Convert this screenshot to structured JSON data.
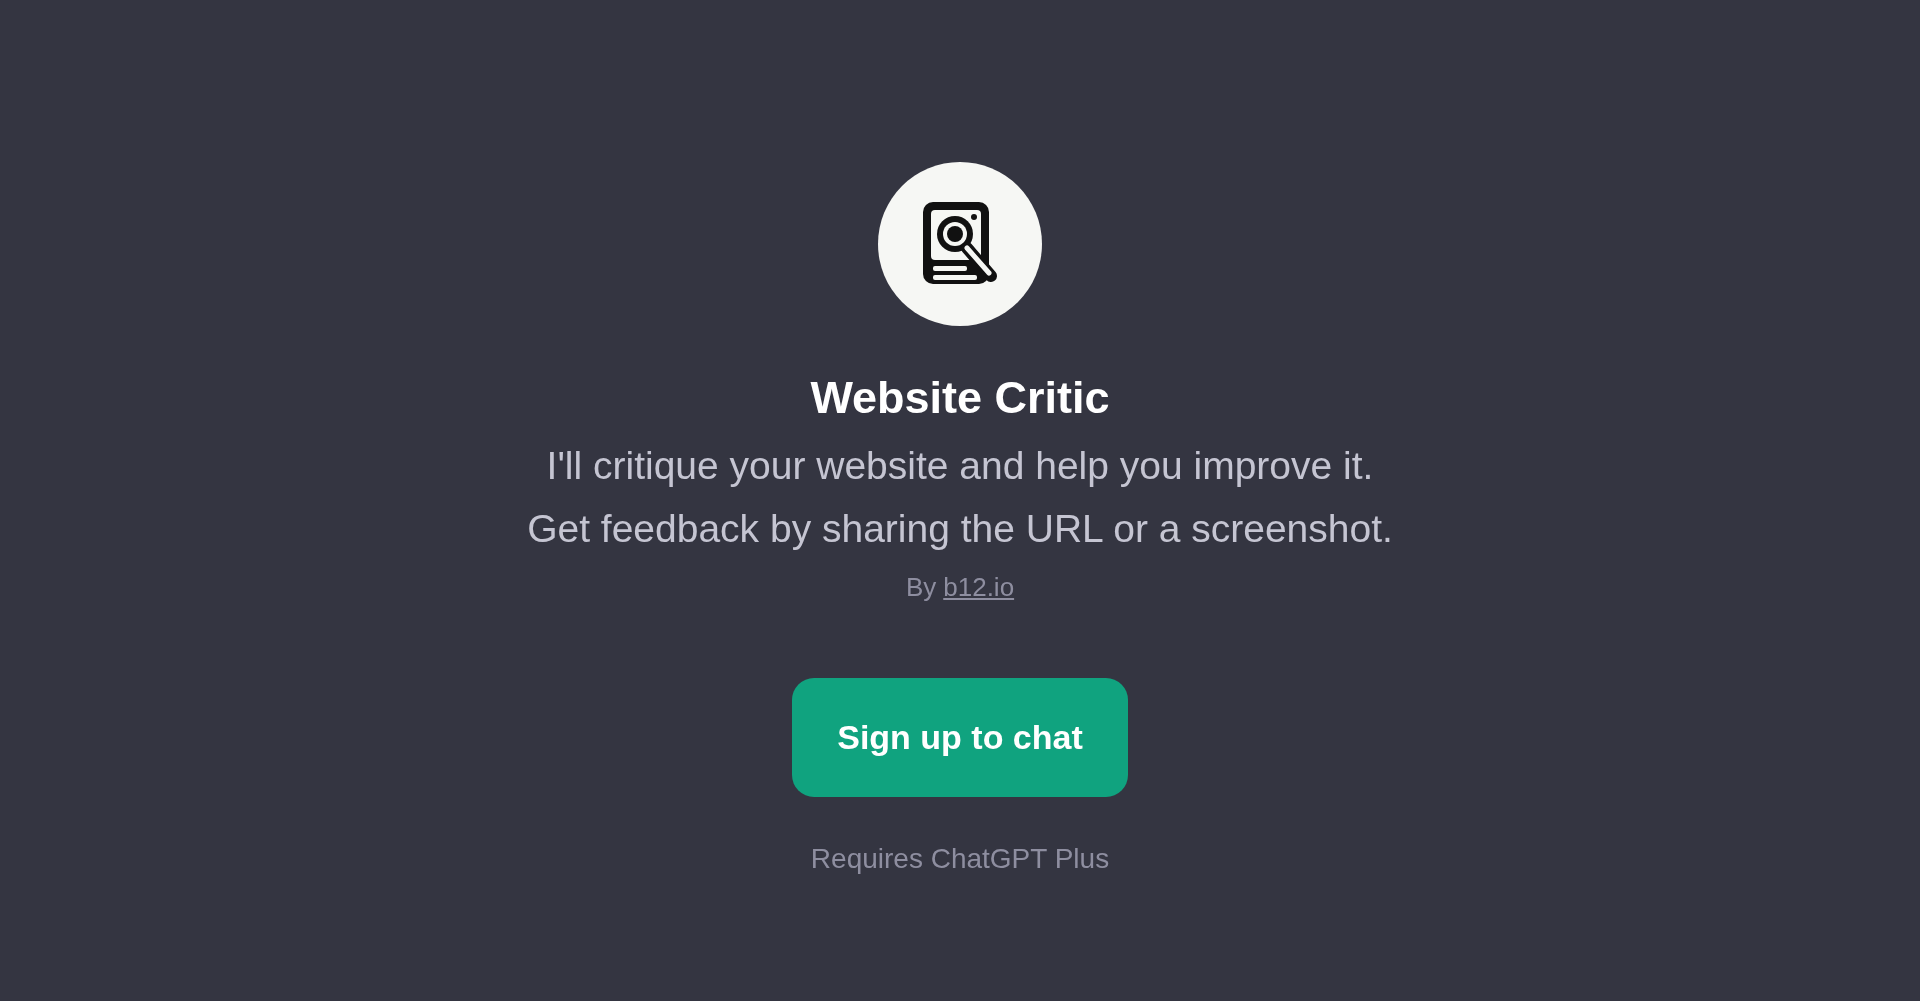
{
  "gpt": {
    "name": "Website Critic",
    "description": [
      "I'll critique your website and help you improve it.",
      "Get feedback by sharing the URL or a screenshot."
    ],
    "author_prefix": "By",
    "author_link": "b12.io"
  },
  "button": {
    "label": "Sign up to chat"
  },
  "note": "Requires ChatGPT Plus"
}
